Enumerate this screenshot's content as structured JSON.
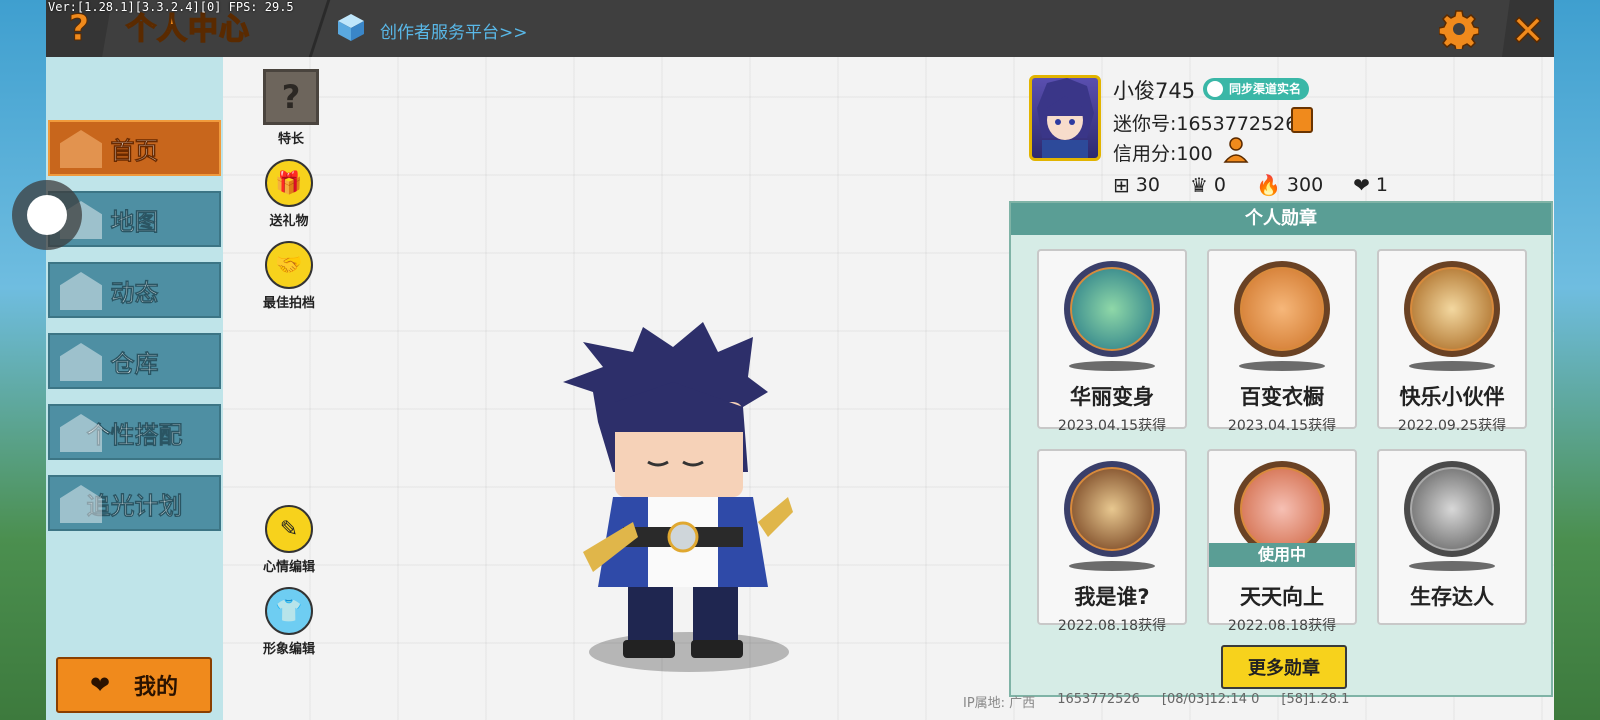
{
  "debug": {
    "text": "Ver:[1.28.1][3.3.2.4][0] FPS: 29.5"
  },
  "topbar": {
    "help_label": "?",
    "title": "个人中心",
    "creator_link": "创作者服务平台>>",
    "close_label": "×"
  },
  "sidebar": {
    "items": [
      {
        "label": "首页",
        "icon": "home-icon"
      },
      {
        "label": "地图",
        "icon": "map-icon"
      },
      {
        "label": "动态",
        "icon": "bell-icon"
      },
      {
        "label": "仓库",
        "icon": "house-icon"
      },
      {
        "label": "个性搭配",
        "icon": "style-icon"
      },
      {
        "label": "追光计划",
        "icon": "plan-icon"
      }
    ],
    "mine_label": "我的"
  },
  "actions": {
    "talent": "特长",
    "gift": "送礼物",
    "partner": "最佳拍档",
    "mood": "心情编辑",
    "image": "形象编辑"
  },
  "profile": {
    "username": "小俊745",
    "sync_badge": "同步渠道实名",
    "mini_id": "迷你号:1653772526",
    "credit": "信用分:100",
    "stats": {
      "likes": "30",
      "fans": "0",
      "popularity": "300",
      "hearts": "1"
    }
  },
  "medals": {
    "title": "个人勋章",
    "items": [
      {
        "name": "华丽变身",
        "date": "2023.04.15获得"
      },
      {
        "name": "百变衣橱",
        "date": "2023.04.15获得"
      },
      {
        "name": "快乐小伙伴",
        "date": "2022.09.25获得"
      },
      {
        "name": "我是谁?",
        "date": "2022.08.18获得"
      },
      {
        "name": "天天向上",
        "date": "2022.08.18获得",
        "badge": "使用中"
      },
      {
        "name": "生存达人",
        "date": ""
      }
    ],
    "more_label": "更多勋章"
  },
  "footer": {
    "ip": "IP属地: 广西",
    "uid": "1653772526",
    "time": "[08/03]12:14 0",
    "ver": "[58]1.28.1"
  },
  "colors": {
    "accent_orange": "#f08a1c",
    "nav_blue": "#4e8fa3",
    "teal": "#5a9e95",
    "yellow": "#f7d21c"
  }
}
